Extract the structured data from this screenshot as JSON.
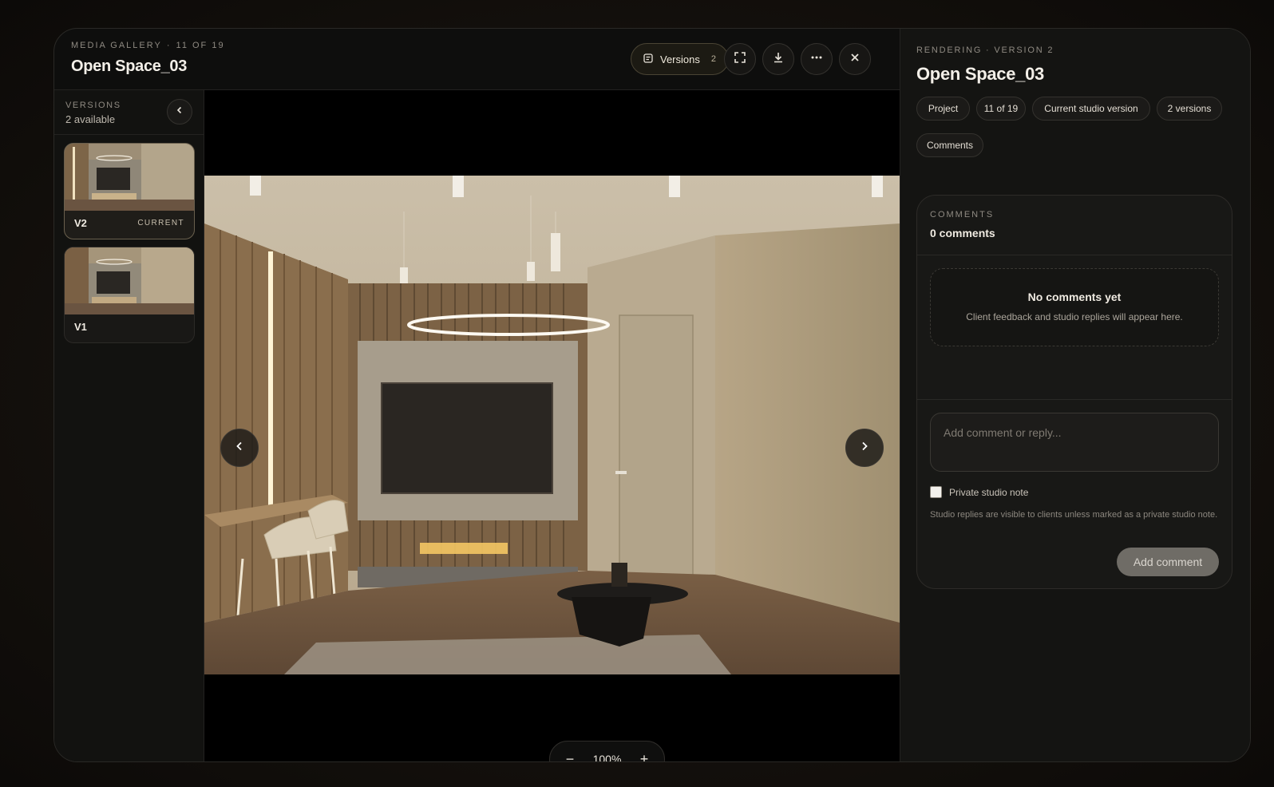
{
  "header": {
    "overline": "MEDIA GALLERY",
    "position": "11 OF 19",
    "title": "Open Space_03",
    "versions_label": "Versions",
    "versions_count": "2"
  },
  "sidebar": {
    "overline": "VERSIONS",
    "subtitle": "2 available",
    "items": [
      {
        "name": "V2",
        "tag": "CURRENT"
      },
      {
        "name": "V1",
        "tag": ""
      }
    ]
  },
  "viewer": {
    "zoom_value": "100%",
    "zoom_out": "−",
    "zoom_in": "+"
  },
  "panel": {
    "overline": "RENDERING · VERSION 2",
    "title": "Open Space_03",
    "chips": [
      "Project",
      "11 of 19",
      "Current studio version",
      "2 versions",
      "Comments"
    ],
    "comments": {
      "overline": "COMMENTS",
      "count": "0 comments",
      "empty_title": "No comments yet",
      "empty_subtitle": "Client feedback and studio replies will appear here.",
      "input_placeholder": "Add comment or reply...",
      "private_label": "Private studio note",
      "private_checked": false,
      "hint": "Studio replies are visible to clients unless marked as a private studio note.",
      "submit_label": "Add comment"
    }
  },
  "icons": [
    "versions-icon",
    "fullscreen-icon",
    "download-icon",
    "more-icon",
    "close-icon",
    "chevron-left-icon",
    "chevron-right-icon"
  ],
  "colors": {
    "background": "#0e0e0d",
    "panel": "#141412",
    "accent_border": "#6a604e",
    "button_disabled": "#6f6c66"
  }
}
